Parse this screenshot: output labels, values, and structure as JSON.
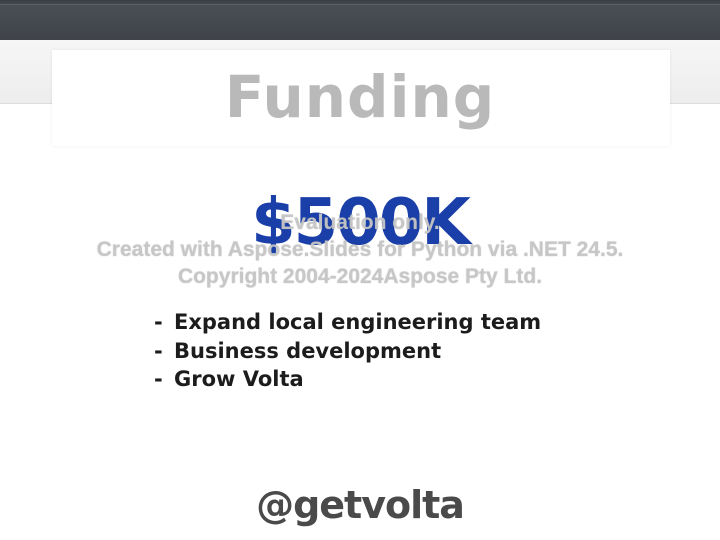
{
  "slide": {
    "title": "Funding",
    "amount": "$500K",
    "bullets": [
      "Expand local engineering team",
      "Business development",
      "Grow Volta"
    ],
    "bullet_marker": "-",
    "handle": "@getvolta"
  },
  "watermark": {
    "line1": "Evaluation only.",
    "line2": "Created with Aspose.Slides for Python via .NET 24.5.",
    "line3": "Copyright 2004-2024Aspose Pty Ltd."
  },
  "colors": {
    "title": "#b9b9b9",
    "amount": "#1a3fa8",
    "bullet_text": "#1c1c1c",
    "handle": "#4a4a4a",
    "top_bar": "#3f4348"
  }
}
